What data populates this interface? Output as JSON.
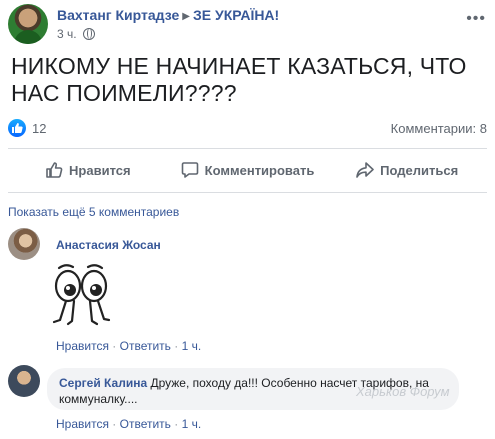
{
  "post": {
    "author": "Вахтанг Киртадзе",
    "group": "ЗЕ УКРАЇНА!",
    "time": "3 ч.",
    "text": "НИКОМУ НЕ НАЧИНАЕТ КАЗАТЬСЯ, ЧТО НАС ПОИМЕЛИ????",
    "reactions_count": "12",
    "comments_count": "Комментарии: 8"
  },
  "actions": {
    "like": "Нравится",
    "comment": "Комментировать",
    "share": "Поделиться"
  },
  "comments_section": {
    "show_more": "Показать ещё 5 комментариев",
    "items": [
      {
        "author": "Анастасия Жосан",
        "text": "",
        "like": "Нравится",
        "reply": "Ответить",
        "time": "1 ч."
      },
      {
        "author": "Сергей Калина",
        "text": "Друже, походу да!!! Особенно насчет тарифов, на коммуналку....",
        "like": "Нравится",
        "reply": "Ответить",
        "time": "1 ч."
      }
    ]
  },
  "watermark": "Харьков Форум",
  "colors": {
    "link": "#385898",
    "meta": "#606770",
    "like_blue": "#0866ff"
  }
}
